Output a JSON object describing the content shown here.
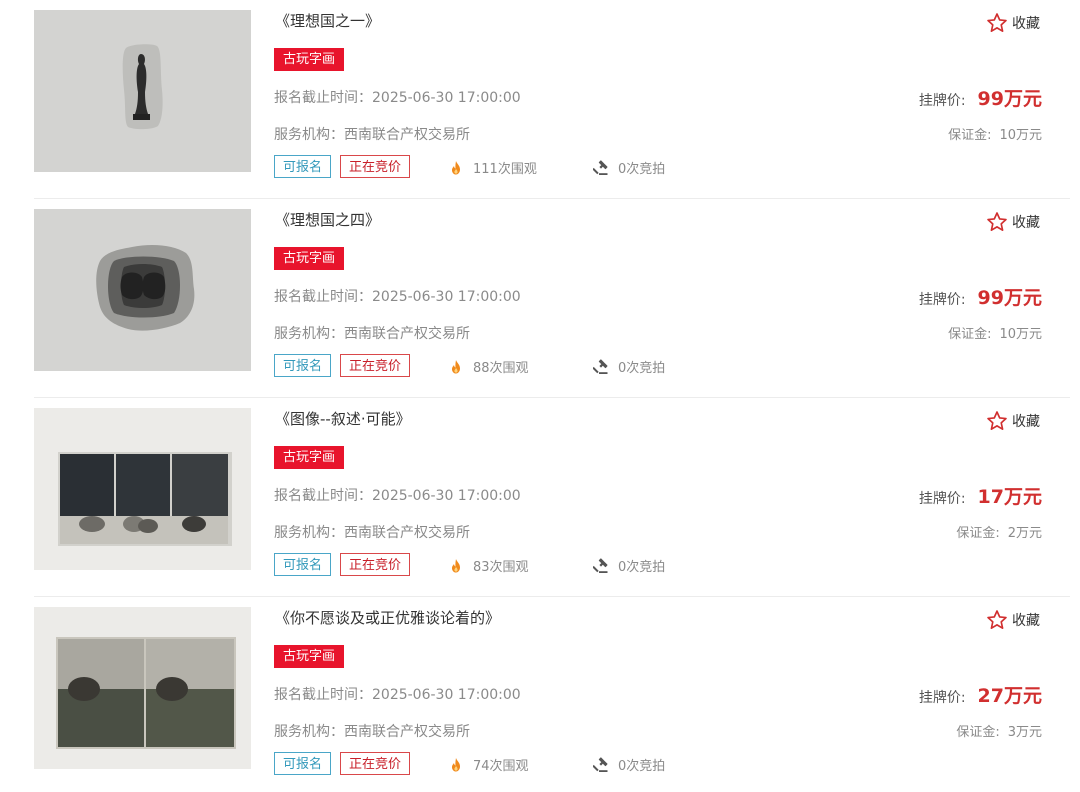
{
  "items": [
    {
      "title": "《理想国之一》",
      "category": "古玩字画",
      "deadline": "报名截止时间：2025-06-30 17:00:00",
      "org": "服务机构：西南联合产权交易所",
      "tag_signup": "可报名",
      "tag_bidding": "正在竞价",
      "views": "111次围观",
      "bids": "0次竞拍",
      "fav_label": "收藏",
      "price_label": "挂牌价:",
      "price": "99万元",
      "deposit_label": "保证金:",
      "deposit": "10万元"
    },
    {
      "title": "《理想国之四》",
      "category": "古玩字画",
      "deadline": "报名截止时间：2025-06-30 17:00:00",
      "org": "服务机构：西南联合产权交易所",
      "tag_signup": "可报名",
      "tag_bidding": "正在竞价",
      "views": "88次围观",
      "bids": "0次竞拍",
      "fav_label": "收藏",
      "price_label": "挂牌价:",
      "price": "99万元",
      "deposit_label": "保证金:",
      "deposit": "10万元"
    },
    {
      "title": "《图像--叙述·可能》",
      "category": "古玩字画",
      "deadline": "报名截止时间：2025-06-30 17:00:00",
      "org": "服务机构：西南联合产权交易所",
      "tag_signup": "可报名",
      "tag_bidding": "正在竞价",
      "views": "83次围观",
      "bids": "0次竞拍",
      "fav_label": "收藏",
      "price_label": "挂牌价:",
      "price": "17万元",
      "deposit_label": "保证金:",
      "deposit": "2万元"
    },
    {
      "title": "《你不愿谈及或正优雅谈论着的》",
      "category": "古玩字画",
      "deadline": "报名截止时间：2025-06-30 17:00:00",
      "org": "服务机构：西南联合产权交易所",
      "tag_signup": "可报名",
      "tag_bidding": "正在竞价",
      "views": "74次围观",
      "bids": "0次竞拍",
      "fav_label": "收藏",
      "price_label": "挂牌价:",
      "price": "27万元",
      "deposit_label": "保证金:",
      "deposit": "3万元"
    }
  ],
  "colors": {
    "badge": "#e8142c",
    "price": "#d12f2f",
    "tag_signup": "#3399bb",
    "tag_bidding": "#c8202a",
    "star": "#d12f2f",
    "fire": "#f08a1c"
  },
  "icons": {
    "fav": "star-outline-icon",
    "views": "fire-icon",
    "bids": "gavel-icon"
  }
}
